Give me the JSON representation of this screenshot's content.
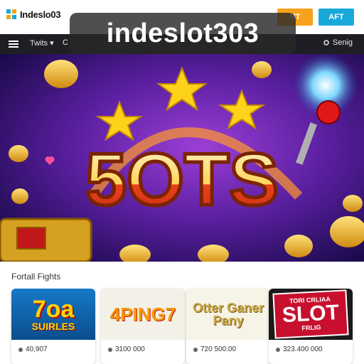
{
  "header": {
    "logo_text": "Indeslo03",
    "btn_orange_label": "NT",
    "btn_blue_label": "AFT",
    "brand_color_orange": "#f6a21a",
    "brand_color_blue": "#19a9d8"
  },
  "overlay": {
    "title": "indeslot303"
  },
  "nav": {
    "item1": "Twits",
    "item2": "C",
    "right_label": "Senig",
    "bg_color": "#1e1e24"
  },
  "hero": {
    "headline": "5OTS"
  },
  "section": {
    "label": "Fortall Fights"
  },
  "games": [
    {
      "title_big": "7oa",
      "title_small": "SUIRLES",
      "price": "40,907"
    },
    {
      "title_big": "4PING7",
      "title_small": "",
      "price": "3100 000"
    },
    {
      "title_big": "Otter Ganer Pany",
      "title_small": "",
      "price": "720 500.00"
    },
    {
      "title_big": "SLOT",
      "title_small": "TORI CRLIAA",
      "title_sub": "FRLIG",
      "price": "323.400 000"
    }
  ]
}
